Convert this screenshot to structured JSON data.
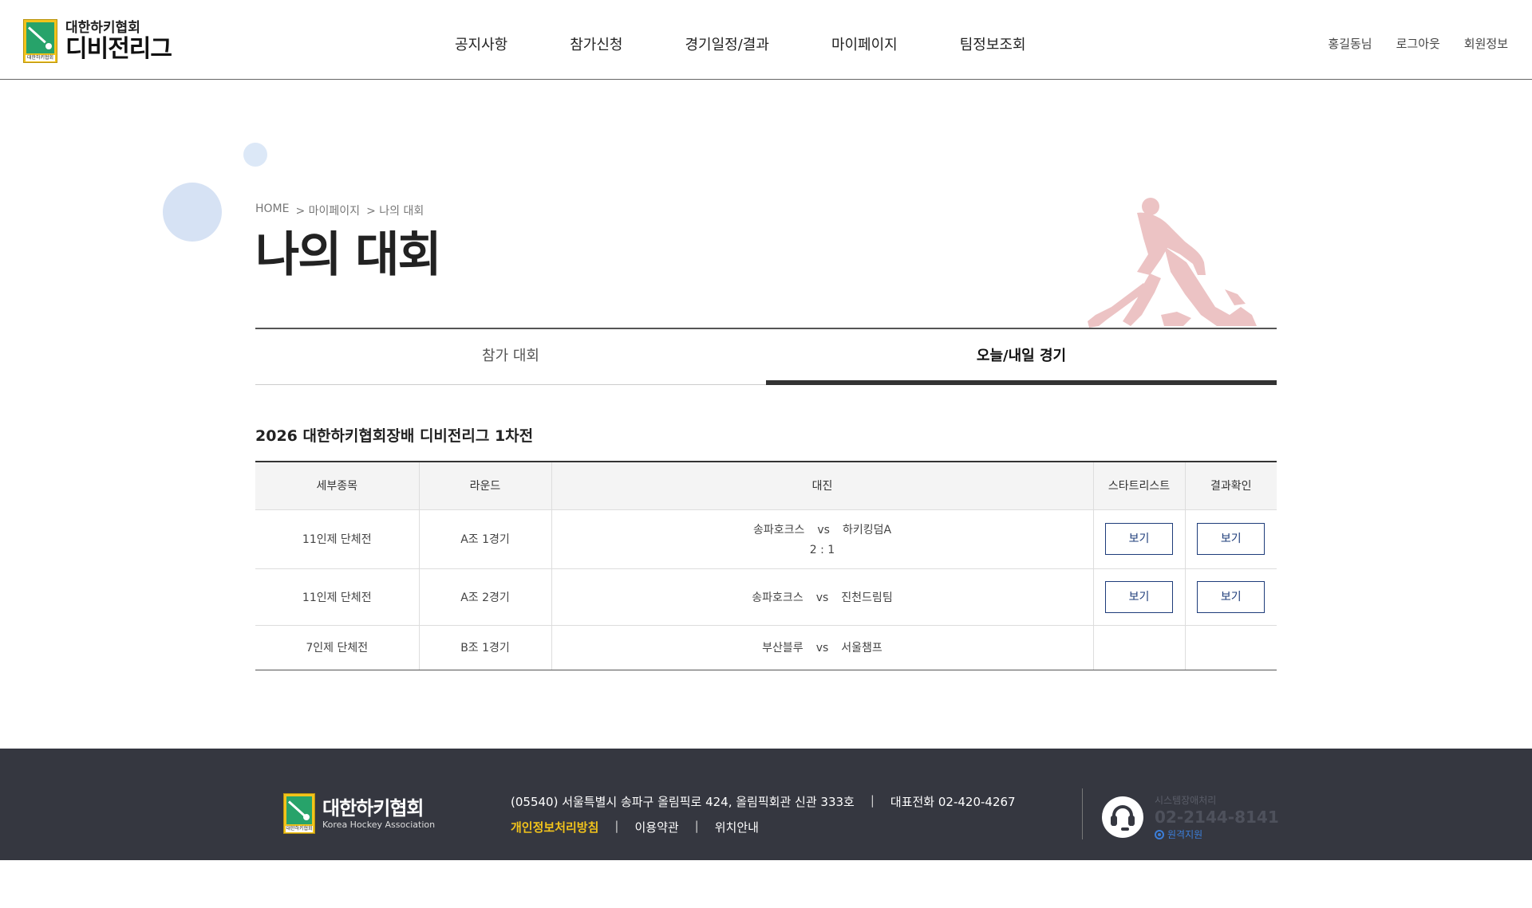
{
  "header": {
    "logo": {
      "sub": "대한하키협회",
      "main": "디비전리그",
      "mark_caption": "대한하키협회"
    },
    "nav": [
      "공지사항",
      "참가신청",
      "경기일정/결과",
      "마이페이지",
      "팀정보조회"
    ],
    "util": [
      "홍길동님",
      "로그아웃",
      "회원정보"
    ]
  },
  "breadcrumb": [
    "HOME",
    "> 마이페이지",
    "> 나의 대회"
  ],
  "page_title": "나의 대회",
  "tabs": [
    {
      "label": "참가 대회",
      "active": false
    },
    {
      "label": "오늘/내일 경기",
      "active": true
    }
  ],
  "section_title": "2026 대한하키협회장배 디비전리그 1차전",
  "table": {
    "headers": [
      "세부종목",
      "라운드",
      "대진",
      "스타트리스트",
      "결과확인"
    ],
    "rows": [
      {
        "event": "11인제 단체전",
        "round": "A조 1경기",
        "team_a": "송파호크스",
        "vs": "vs",
        "team_b": "하키킹덤A",
        "score": "2 : 1",
        "startlist": "보기",
        "result": "보기"
      },
      {
        "event": "11인제 단체전",
        "round": "A조 2경기",
        "team_a": "송파호크스",
        "vs": "vs",
        "team_b": "진천드림팀",
        "score": "",
        "startlist": "보기",
        "result": "보기"
      },
      {
        "event": "7인제 단체전",
        "round": "B조 1경기",
        "team_a": "부산블루",
        "vs": "vs",
        "team_b": "서울챔프",
        "score": "",
        "startlist": "",
        "result": ""
      }
    ]
  },
  "footer": {
    "logo_ko": "대한하키협회",
    "logo_en": "Korea Hockey Association",
    "address": "(05540) 서울특별시 송파구 올림픽로 424, 올림픽회관 신관 333호",
    "sep": "|",
    "phone": "대표전화 02-420-4267",
    "links": [
      "개인정보처리방침",
      "이용약관",
      "위치안내"
    ],
    "support_label": "시스템장애처리",
    "support_phone": "02-2144-8141",
    "support_remote": "원격지원"
  },
  "colors": {
    "accent_navy": "#1e3c7a",
    "footer_bg": "#353740",
    "logo_yellow": "#f2c31b",
    "logo_green": "#27a36a"
  }
}
